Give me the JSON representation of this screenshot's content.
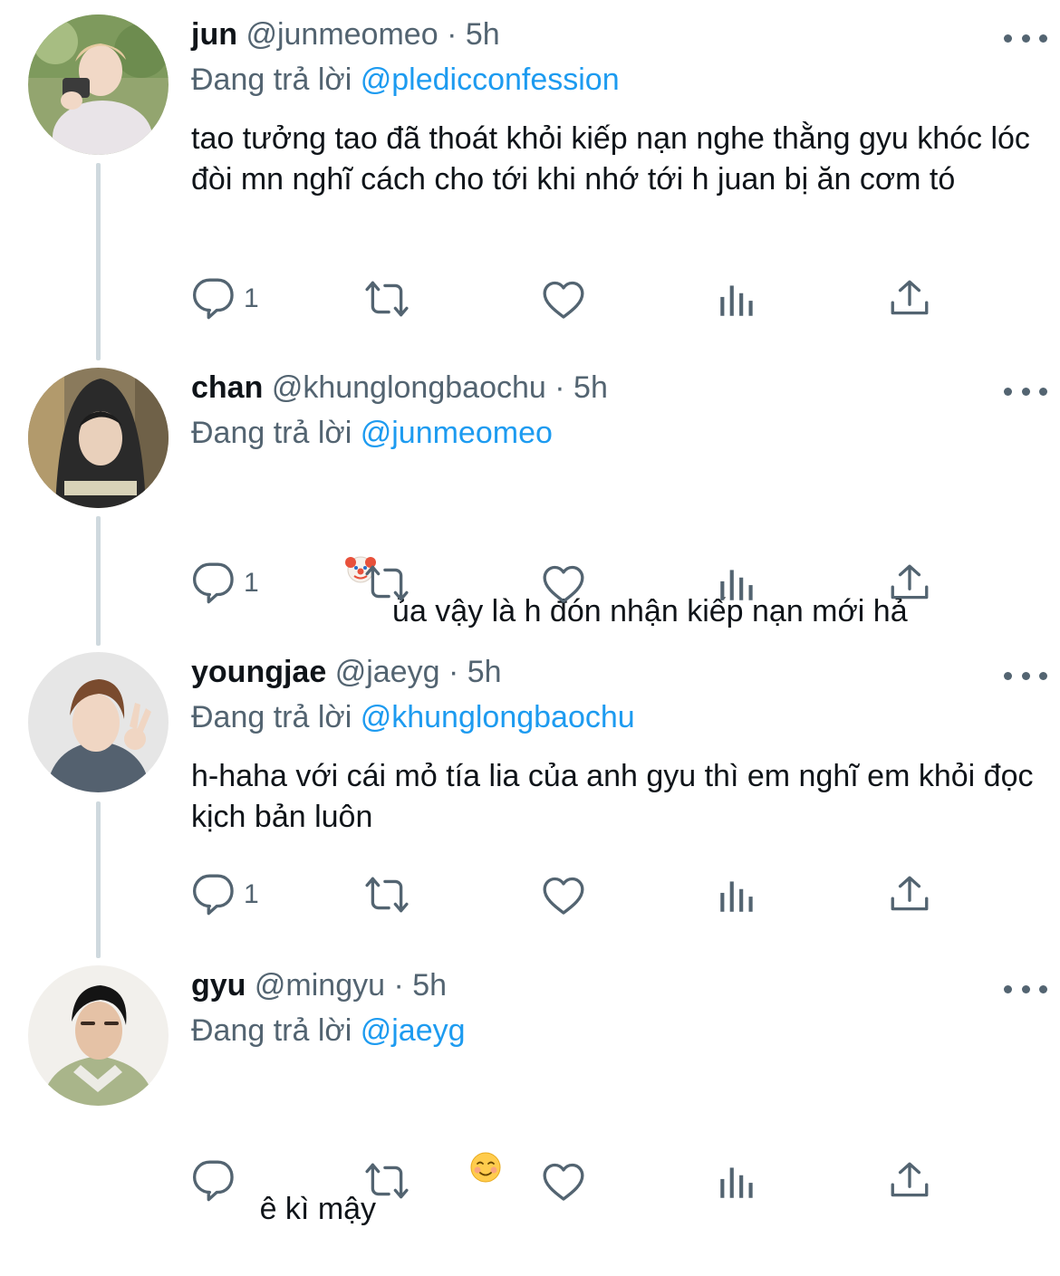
{
  "tweets": [
    {
      "name": "jun",
      "handle": "@junmeomeo",
      "dot": "·",
      "time": "5h",
      "reply_prefix": "Đang trả lời",
      "reply_to": "@pledicconfession",
      "text": "tao tưởng tao đã thoát khỏi kiếp nạn nghe thằng gyu khóc lóc đòi mn nghĩ cách cho tới khi nhớ tới h juan bị ăn cơm tó",
      "reply_count": "1",
      "leading_emoji": "",
      "trailing_emoji": ""
    },
    {
      "name": "chan",
      "handle": "@khunglongbaochu",
      "dot": "·",
      "time": "5h",
      "reply_prefix": "Đang trả lời",
      "reply_to": "@junmeomeo",
      "text": "ủa vậy là h đón nhận kiếp nạn mới hả",
      "reply_count": "1",
      "leading_emoji": "clown-face-emoji",
      "trailing_emoji": ""
    },
    {
      "name": "youngjae",
      "handle": "@jaeyg",
      "dot": "·",
      "time": "5h",
      "reply_prefix": "Đang trả lời",
      "reply_to": "@khunglongbaochu",
      "text": "h-haha với cái mỏ tía lia của anh gyu thì em nghĩ em khỏi đọc kịch bản luôn",
      "reply_count": "1",
      "leading_emoji": "",
      "trailing_emoji": ""
    },
    {
      "name": "gyu",
      "handle": "@mingyu",
      "dot": "·",
      "time": "5h",
      "reply_prefix": "Đang trả lời",
      "reply_to": "@jaeyg",
      "text": "ê kì mậy",
      "reply_count": "",
      "leading_emoji": "",
      "trailing_emoji": "smiling-face-emoji"
    }
  ],
  "icons": {
    "reply": "reply-icon",
    "retweet": "retweet-icon",
    "like": "like-icon",
    "views": "views-icon",
    "share": "share-icon",
    "more": "more-icon"
  },
  "colors": {
    "text": "#0f1419",
    "secondary": "#536471",
    "accent": "#1d9bf0",
    "thread_line": "#cfd9de"
  }
}
